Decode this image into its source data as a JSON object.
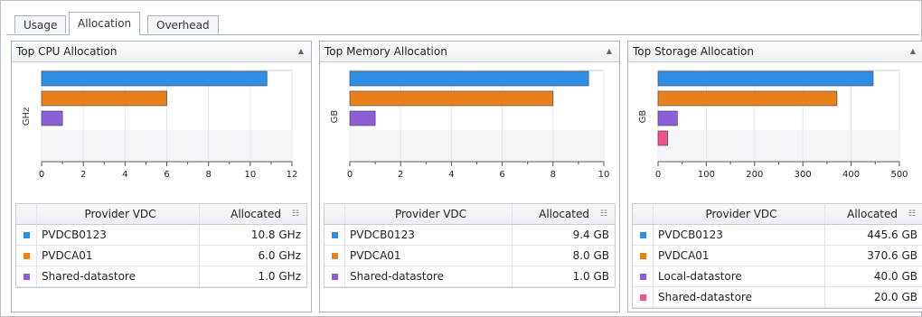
{
  "tabs": [
    {
      "label": "Usage"
    },
    {
      "label": "Allocation"
    },
    {
      "label": "Overhead"
    }
  ],
  "panels": [
    {
      "title": "Top CPU Allocation",
      "grid": {
        "col_name": "Provider VDC",
        "col_value": "Allocated"
      },
      "rows": [
        {
          "name": "PVDCB0123",
          "value": "10.8 GHz",
          "color": "#2f8fe6"
        },
        {
          "name": "PVDCA01",
          "value": "6.0 GHz",
          "color": "#e8801c"
        },
        {
          "name": "Shared-datastore",
          "value": "1.0 GHz",
          "color": "#8c5fd6"
        }
      ]
    },
    {
      "title": "Top Memory Allocation",
      "grid": {
        "col_name": "Provider VDC",
        "col_value": "Allocated"
      },
      "rows": [
        {
          "name": "PVDCB0123",
          "value": "9.4 GB",
          "color": "#2f8fe6"
        },
        {
          "name": "PVDCA01",
          "value": "8.0 GB",
          "color": "#e8801c"
        },
        {
          "name": "Shared-datastore",
          "value": "1.0 GB",
          "color": "#8c5fd6"
        }
      ]
    },
    {
      "title": "Top Storage Allocation",
      "grid": {
        "col_name": "Provider VDC",
        "col_value": "Allocated"
      },
      "rows": [
        {
          "name": "PVDCB0123",
          "value": "445.6 GB",
          "color": "#2f8fe6"
        },
        {
          "name": "PVDCA01",
          "value": "370.6 GB",
          "color": "#e8801c"
        },
        {
          "name": "Local-datastore",
          "value": "40.0 GB",
          "color": "#8c5fd6"
        },
        {
          "name": "Shared-datastore",
          "value": "20.0 GB",
          "color": "#f0528f"
        }
      ]
    }
  ],
  "chart_data": [
    {
      "type": "bar",
      "title": "Top CPU Allocation",
      "orientation": "horizontal",
      "categories": [
        "PVDCB0123",
        "PVDCA01",
        "Shared-datastore"
      ],
      "values": [
        10.8,
        6.0,
        1.0
      ],
      "colors": [
        "#2f8fe6",
        "#e8801c",
        "#8c5fd6"
      ],
      "ylabel": "GHz",
      "xlim": [
        0,
        12
      ],
      "xticks": [
        0,
        2,
        4,
        6,
        8,
        10,
        12
      ]
    },
    {
      "type": "bar",
      "title": "Top Memory Allocation",
      "orientation": "horizontal",
      "categories": [
        "PVDCB0123",
        "PVDCA01",
        "Shared-datastore"
      ],
      "values": [
        9.4,
        8.0,
        1.0
      ],
      "colors": [
        "#2f8fe6",
        "#e8801c",
        "#8c5fd6"
      ],
      "ylabel": "GB",
      "xlim": [
        0,
        10
      ],
      "xticks": [
        0,
        2,
        4,
        6,
        8,
        10
      ]
    },
    {
      "type": "bar",
      "title": "Top Storage Allocation",
      "orientation": "horizontal",
      "categories": [
        "PVDCB0123",
        "PVDCA01",
        "Local-datastore",
        "Shared-datastore"
      ],
      "values": [
        445.6,
        370.6,
        40.0,
        20.0
      ],
      "colors": [
        "#2f8fe6",
        "#e8801c",
        "#8c5fd6",
        "#f0528f"
      ],
      "ylabel": "GB",
      "xlim": [
        0,
        500
      ],
      "xticks": [
        0,
        100,
        200,
        300,
        400,
        500
      ]
    }
  ]
}
